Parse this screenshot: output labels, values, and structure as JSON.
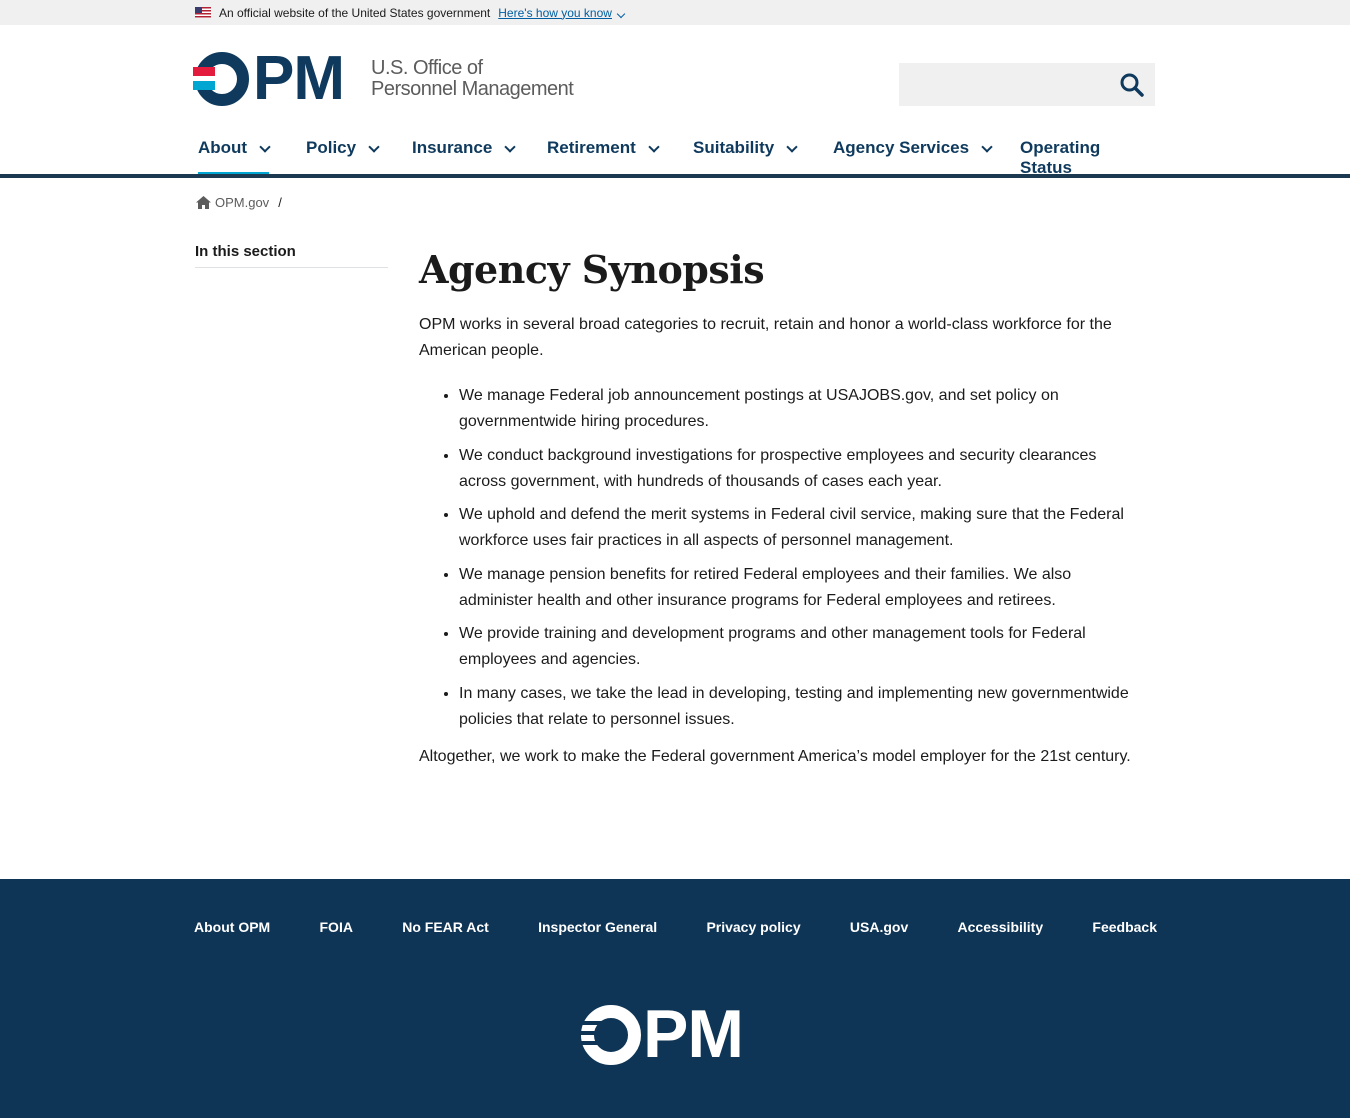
{
  "banner": {
    "text": "An official website of the United States government",
    "link": "Here's how you know"
  },
  "header": {
    "logo_letters": "PM",
    "logo_line1": "U.S. Office of",
    "logo_line2": "Personnel Management",
    "search_placeholder": ""
  },
  "nav": {
    "items": [
      {
        "label": "About",
        "has_dropdown": true,
        "active": true
      },
      {
        "label": "Policy",
        "has_dropdown": true
      },
      {
        "label": "Insurance",
        "has_dropdown": true
      },
      {
        "label": "Retirement",
        "has_dropdown": true
      },
      {
        "label": "Suitability",
        "has_dropdown": true
      },
      {
        "label": "Agency Services",
        "has_dropdown": true
      },
      {
        "label": "Operating Status",
        "has_dropdown": false
      }
    ]
  },
  "breadcrumb": {
    "home": "OPM.gov",
    "separator": "/"
  },
  "sidenav": {
    "title": "In this section"
  },
  "main": {
    "title": "Agency Synopsis",
    "intro": "OPM works in several broad categories to recruit, retain and honor a world-class workforce for the American people.",
    "bullets": [
      "We manage Federal job announcement postings at USAJOBS.gov, and set policy on governmentwide hiring procedures.",
      "We conduct background investigations for prospective employees and security clearances across government, with hundreds of thousands of cases each year.",
      "We uphold and defend the merit systems in Federal civil service, making sure that the Federal workforce uses fair practices in all aspects of personnel management.",
      "We manage pension benefits for retired Federal employees and their families.  We also administer health and other insurance programs for Federal employees and retirees.",
      "We provide training and development programs and other management tools for Federal employees and agencies.",
      "In many cases, we take the lead in developing, testing and implementing new governmentwide policies that relate to personnel issues."
    ],
    "outro": "Altogether, we work to make the Federal government America’s model employer for the 21st century."
  },
  "footer": {
    "links": [
      "About OPM",
      "FOIA",
      "No FEAR Act",
      "Inspector General",
      "Privacy policy",
      "USA.gov",
      "Accessibility",
      "Feedback"
    ],
    "logo_letters": "PM"
  },
  "colors": {
    "brand_navy": "#0f3a5d",
    "accent_cyan": "#00a6d2",
    "accent_red": "#e31c3d",
    "footer_bg": "#0f3556"
  }
}
